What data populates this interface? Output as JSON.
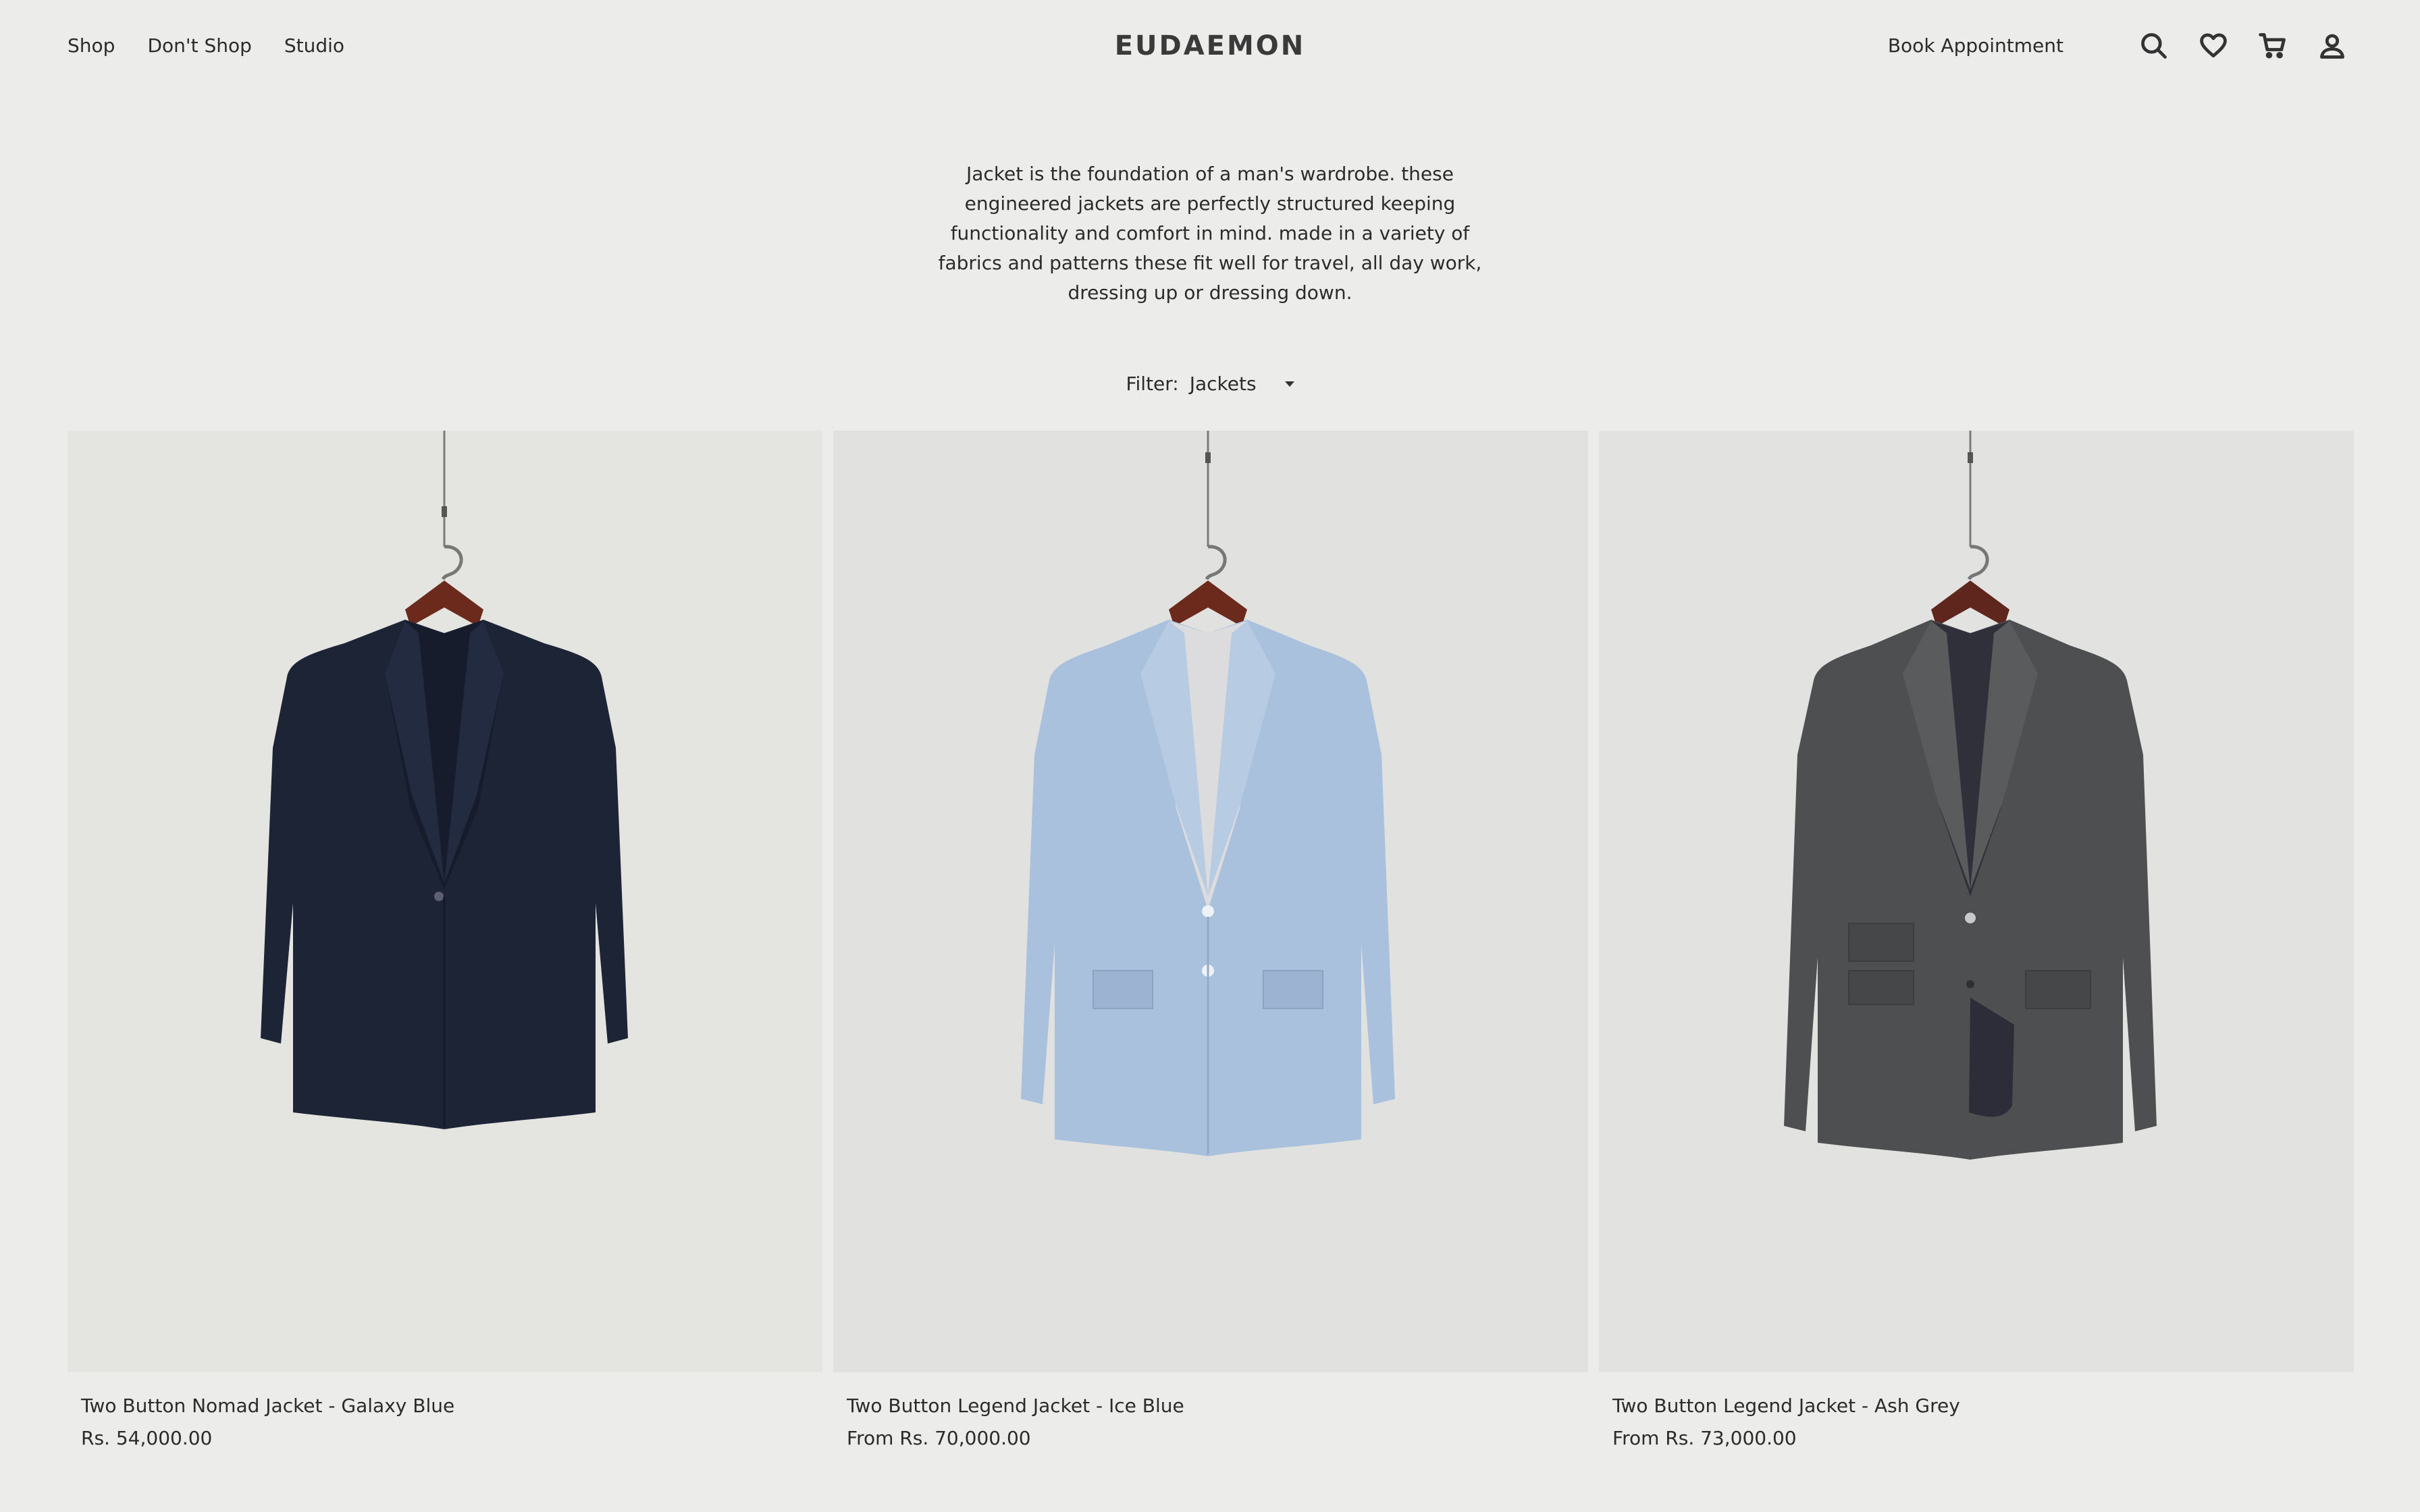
{
  "header": {
    "nav": [
      "Shop",
      "Don't Shop",
      "Studio"
    ],
    "logo": "EUDAEMON",
    "book_appointment": "Book Appointment",
    "icons": [
      "search-icon",
      "heart-icon",
      "cart-icon",
      "account-icon"
    ]
  },
  "intro": "Jacket is the foundation of a man's wardrobe. these engineered jackets are perfectly structured keeping functionality and comfort in mind. made in a variety of fabrics and patterns these fit well for travel, all day work, dressing up or dressing down.",
  "filter": {
    "label": "Filter:",
    "value": "Jackets"
  },
  "products": [
    {
      "title": "Two Button Nomad Jacket - Galaxy Blue",
      "price": "Rs. 54,000.00",
      "color": "#1d2436"
    },
    {
      "title": "Two Button Legend Jacket - Ice Blue",
      "price": "From Rs. 70,000.00",
      "color": "#a9c1dd"
    },
    {
      "title": "Two Button Legend Jacket - Ash Grey",
      "price": "From Rs. 73,000.00",
      "color": "#4e4f51"
    }
  ]
}
